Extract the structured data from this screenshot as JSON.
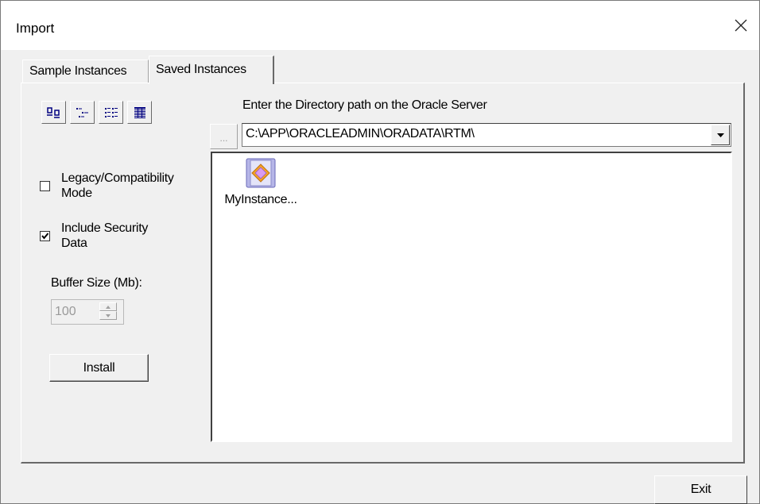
{
  "window": {
    "title": "Import"
  },
  "tabs": [
    {
      "label": "Sample Instances",
      "selected": false
    },
    {
      "label": "Saved Instances",
      "selected": true
    }
  ],
  "view_buttons": [
    {
      "icon": "large-icons-view-icon"
    },
    {
      "icon": "small-icons-view-icon"
    },
    {
      "icon": "list-view-icon"
    },
    {
      "icon": "details-view-icon"
    }
  ],
  "options": {
    "legacy": {
      "line1": "Legacy/Compatibility",
      "line2": "Mode",
      "checked": false
    },
    "security": {
      "line1": "Include Security",
      "line2": "Data",
      "checked": true
    }
  },
  "buffer": {
    "label": "Buffer Size (Mb):",
    "value": "100"
  },
  "install_label": "Install",
  "directory": {
    "label": "Enter the Directory path on the Oracle Server",
    "browse_label": "...",
    "path": "C:\\APP\\ORACLEADMIN\\ORADATA\\RTM\\"
  },
  "instances": [
    {
      "label": "MyInstance...",
      "icon": "instance-icon"
    }
  ],
  "exit_label": "Exit",
  "colors": {
    "icon_frame": "#b6b6e8",
    "icon_diamond": "#f5a623"
  }
}
